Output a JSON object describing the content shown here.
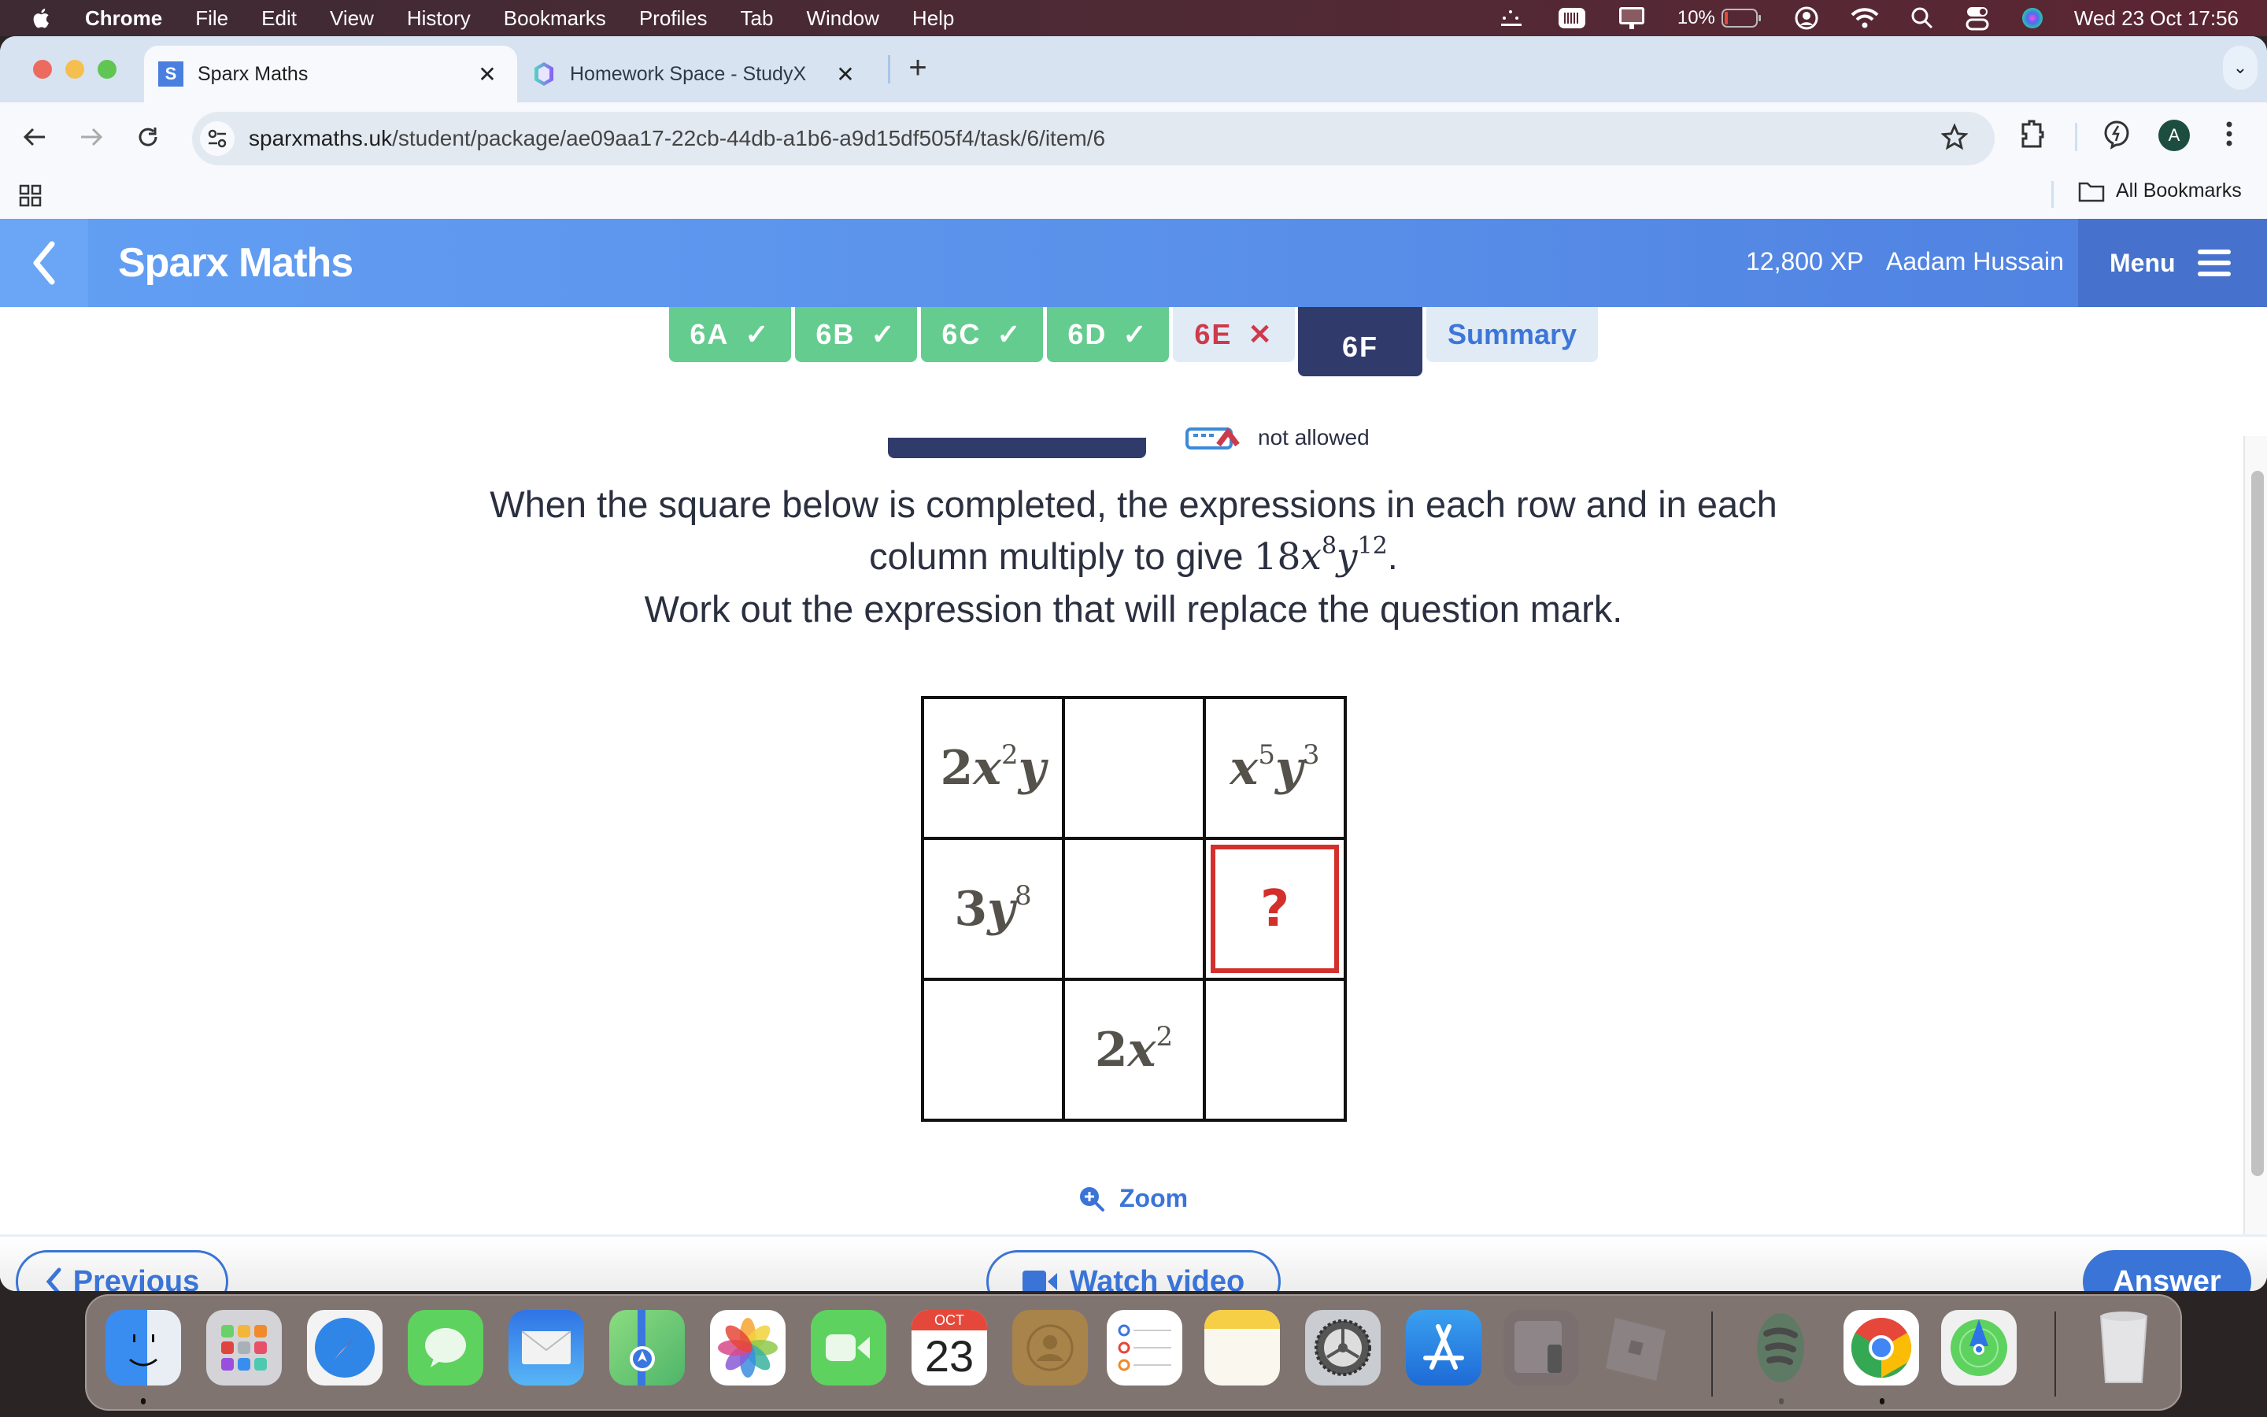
{
  "menubar": {
    "app_name": "Chrome",
    "items": [
      "File",
      "Edit",
      "View",
      "History",
      "Bookmarks",
      "Profiles",
      "Tab",
      "Window",
      "Help"
    ],
    "battery_percent": "10%",
    "battery_level": 0.1,
    "clock": "Wed 23 Oct  17:56",
    "status_icons": [
      "dotted-activity-icon",
      "keyboard-icon",
      "display-icon",
      "battery-icon",
      "user-icon",
      "wifi-icon",
      "search-icon",
      "control-center-icon",
      "siri-icon"
    ]
  },
  "browser": {
    "tabs": [
      {
        "title": "Sparx Maths",
        "favicon": "S",
        "active": true
      },
      {
        "title": "Homework Space - StudyX",
        "active": false
      }
    ],
    "url_domain": "sparxmaths.uk",
    "url_path": "/student/package/ae09aa17-22cb-44db-a1b6-a9d15df505f4/task/6/item/6",
    "profile_initial": "A",
    "bookmarks_label": "All Bookmarks"
  },
  "header": {
    "brand": "Sparx Maths",
    "xp": "12,800 XP",
    "user_name": "Aadam Hussain",
    "menu_label": "Menu"
  },
  "task_tabs": [
    {
      "label": "6A",
      "status": "correct",
      "mark": "✓"
    },
    {
      "label": "6B",
      "status": "correct",
      "mark": "✓"
    },
    {
      "label": "6C",
      "status": "correct",
      "mark": "✓"
    },
    {
      "label": "6D",
      "status": "correct",
      "mark": "✓"
    },
    {
      "label": "6E",
      "status": "incorrect",
      "mark": "✕"
    },
    {
      "label": "6F",
      "status": "current",
      "mark": ""
    },
    {
      "label": "Summary",
      "status": "summary",
      "mark": ""
    }
  ],
  "calculator_note": "not allowed",
  "question": {
    "line1": "When the square below is completed, the expressions in each row and in each",
    "line2_prefix": "column multiply to give ",
    "product": {
      "coef": "18",
      "x_exp": "8",
      "y_exp": "12"
    },
    "line2_suffix": ".",
    "line3": "Work out the expression that will replace the question mark."
  },
  "grid": {
    "cells": [
      [
        "2x^2y",
        "",
        "x^5y^3"
      ],
      [
        "3y^8",
        "",
        "?"
      ],
      [
        "",
        "2x^2",
        ""
      ]
    ],
    "r0c0": {
      "coef": "2",
      "x_exp": "2"
    },
    "r0c2": {
      "x_exp": "5",
      "y_exp": "3"
    },
    "r1c0": {
      "coef": "3",
      "y_exp": "8"
    },
    "r1c2": "?",
    "r2c1": {
      "coef": "2",
      "x_exp": "2"
    }
  },
  "zoom_label": "Zoom",
  "footer": {
    "previous_label": "Previous",
    "watch_video_label": "Watch video",
    "answer_label": "Answer"
  },
  "dock": {
    "calendar_month": "OCT",
    "calendar_day": "23",
    "apps": [
      "Finder",
      "Launchpad",
      "Safari",
      "Messages",
      "Mail",
      "Maps",
      "Photos",
      "FaceTime",
      "Calendar",
      "Contacts",
      "Reminders",
      "Notes",
      "System Settings",
      "App Store",
      "Preview",
      "Roblox",
      "Spotify",
      "Chrome",
      "Find My",
      "Trash"
    ]
  },
  "colors": {
    "accent": "#3a74d6",
    "header_blue": "#5a91ea",
    "done_green": "#65cc8f",
    "wrong_red": "#cc3b4b",
    "current_navy": "#313b6b",
    "target_red": "#d3302c"
  }
}
